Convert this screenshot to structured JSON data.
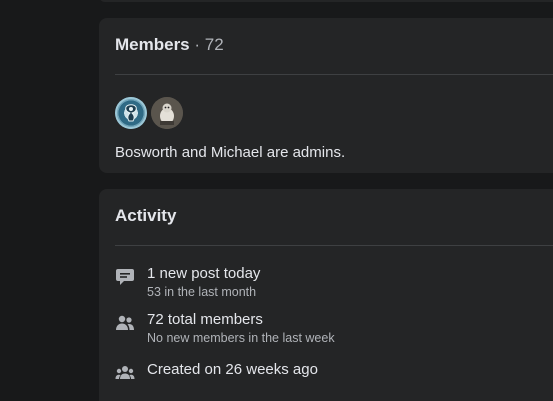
{
  "members": {
    "title": "Members",
    "separator": " · ",
    "count": "72",
    "admins_text": "Bosworth and Michael are admins.",
    "avatars": [
      {
        "name": "Bosworth"
      },
      {
        "name": "Michael"
      }
    ]
  },
  "activity": {
    "title": "Activity",
    "rows": [
      {
        "icon": "chat-bubble-icon",
        "main": "1 new post today",
        "sub": "53 in the last month"
      },
      {
        "icon": "people-icon",
        "main": "72 total members",
        "sub": "No new members in the last week"
      },
      {
        "icon": "group-icon",
        "main": "Created on 26 weeks ago",
        "sub": ""
      }
    ]
  },
  "colors": {
    "page_bg": "#18191a",
    "card_bg": "#242526",
    "primary_text": "#e4e6eb",
    "secondary_text": "#b0b3b8",
    "divider": "#3e4042"
  }
}
